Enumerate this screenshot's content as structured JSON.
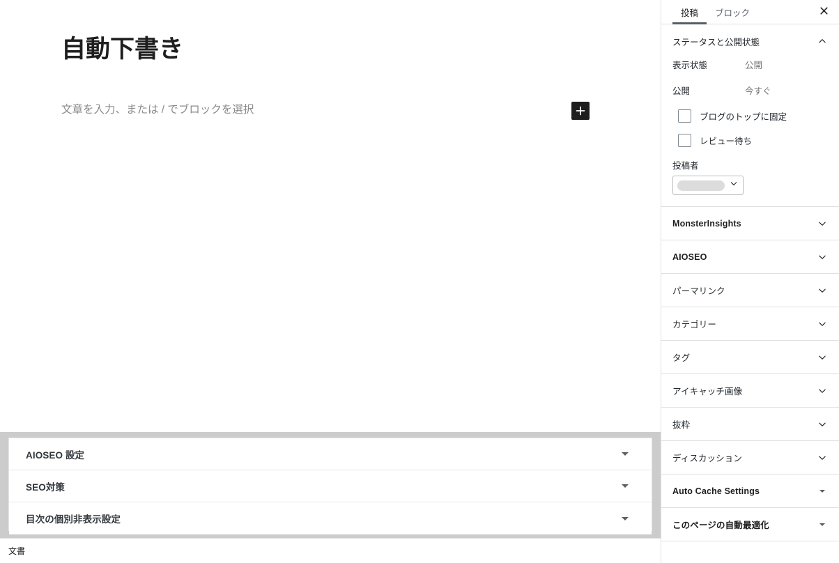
{
  "editor": {
    "post_title": "自動下書き",
    "default_block_placeholder": "文章を入力、または / でブロックを選択",
    "inserter_label": "+",
    "inserter_icon": "plus-icon"
  },
  "metaboxes": {
    "items": [
      {
        "title": "AIOSEO 設定",
        "toggle_icon": "triangle-down-icon"
      },
      {
        "title": "SEO対策",
        "toggle_icon": "triangle-down-icon"
      },
      {
        "title": "目次の個別非表示設定",
        "toggle_icon": "triangle-down-icon"
      }
    ]
  },
  "bottom_bar": {
    "breadcrumb": "文書"
  },
  "sidebar": {
    "tabs": [
      {
        "label": "投稿",
        "active": true
      },
      {
        "label": "ブロック",
        "active": false
      }
    ],
    "close_icon": "close-icon",
    "status_panel": {
      "title": "ステータスと公開状態",
      "collapse_icon": "chevron-up-icon",
      "rows": [
        {
          "label": "表示状態",
          "value": "公開"
        },
        {
          "label": "公開",
          "value": "今すぐ"
        }
      ],
      "checkboxes": [
        {
          "label": "ブログのトップに固定",
          "checked": false
        },
        {
          "label": "レビュー待ち",
          "checked": false
        }
      ],
      "author": {
        "label": "投稿者",
        "value": "",
        "redacted": true,
        "caret_icon": "chevron-down-icon"
      }
    },
    "panels": [
      {
        "label": "MonsterInsights",
        "strong": true,
        "arrow_icon": "chevron-down-icon"
      },
      {
        "label": "AIOSEO",
        "strong": true,
        "arrow_icon": "chevron-down-icon"
      },
      {
        "label": "パーマリンク",
        "strong": false,
        "arrow_icon": "chevron-down-icon"
      },
      {
        "label": "カテゴリー",
        "strong": false,
        "arrow_icon": "chevron-down-icon"
      },
      {
        "label": "タグ",
        "strong": false,
        "arrow_icon": "chevron-down-icon"
      },
      {
        "label": "アイキャッチ画像",
        "strong": false,
        "arrow_icon": "chevron-down-icon"
      },
      {
        "label": "抜粋",
        "strong": false,
        "arrow_icon": "chevron-down-icon"
      },
      {
        "label": "ディスカッション",
        "strong": false,
        "arrow_icon": "chevron-down-icon"
      },
      {
        "label": "Auto Cache Settings",
        "strong": true,
        "arrow_icon": "triangle-down-icon"
      },
      {
        "label": "このページの自動最適化",
        "strong": true,
        "arrow_icon": "triangle-down-icon"
      }
    ]
  },
  "colors": {
    "accent_link": "#757575",
    "tab_underline": "#555d66",
    "inserter_bg": "#1e1e1e",
    "metabox_surround": "#cccccc",
    "border": "#e0e0e0",
    "text_primary": "#1e1e1e",
    "text_secondary": "#23282d",
    "placeholder": "#8b8b8b"
  }
}
